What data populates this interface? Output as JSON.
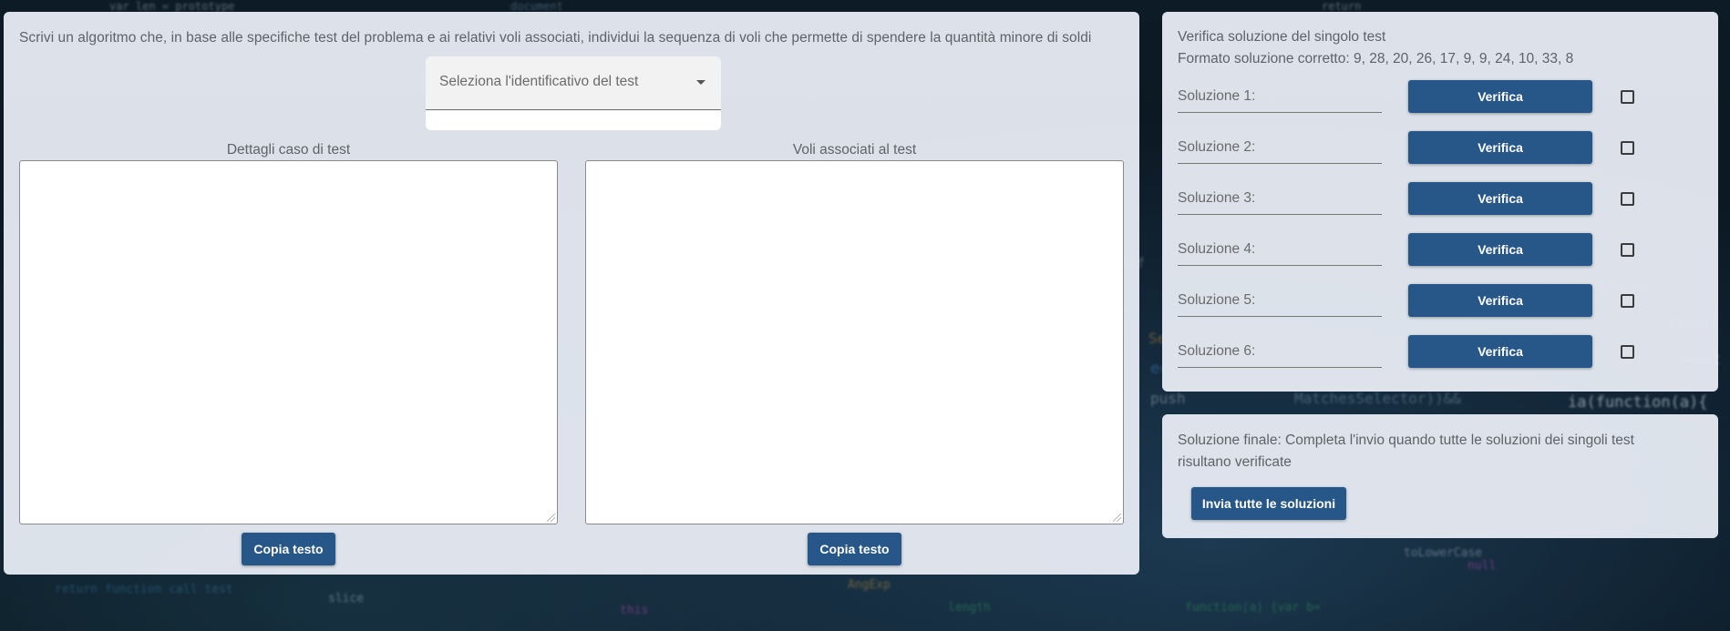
{
  "main": {
    "instructions": "Scrivi un algoritmo che, in base alle specifiche test del problema e ai relativi voli associati, individui la sequenza di voli che permette di spendere la quantità minore di soldi",
    "select": {
      "placeholder": "Seleziona l'identificativo del test"
    },
    "left_column": {
      "label": "Dettagli caso di test",
      "value": "",
      "copy_label": "Copia testo"
    },
    "right_column": {
      "label": "Voli associati al test",
      "value": "",
      "copy_label": "Copia testo"
    }
  },
  "verify": {
    "title": "Verifica soluzione del singolo test",
    "format": "Formato soluzione corretto: 9, 28, 20, 26, 17, 9, 9, 24, 10, 33, 8",
    "solutions": [
      {
        "label": "Soluzione 1:",
        "value": "",
        "button": "Verifica",
        "checked": false
      },
      {
        "label": "Soluzione 2:",
        "value": "",
        "button": "Verifica",
        "checked": false
      },
      {
        "label": "Soluzione 3:",
        "value": "",
        "button": "Verifica",
        "checked": false
      },
      {
        "label": "Soluzione 4:",
        "value": "",
        "button": "Verifica",
        "checked": false
      },
      {
        "label": "Soluzione 5:",
        "value": "",
        "button": "Verifica",
        "checked": false
      },
      {
        "label": "Soluzione 6:",
        "value": "",
        "button": "Verifica",
        "checked": false
      }
    ]
  },
  "final": {
    "text": "Soluzione finale: Completa l'invio quando tutte le soluzioni dei singoli test risultano verificate",
    "submit_label": "Invia tutte le soluzioni"
  },
  "colors": {
    "button": "#275689",
    "panel": "#e8ecf4",
    "background": "#0d1b26"
  }
}
